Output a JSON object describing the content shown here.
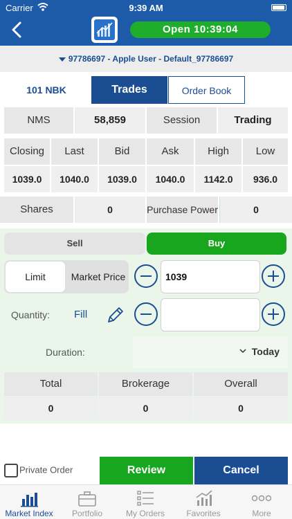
{
  "status_bar": {
    "carrier": "Carrier",
    "time": "9:39 AM"
  },
  "header": {
    "market_status": "Open  10:39:04"
  },
  "account": {
    "label": "97786697 - Apple User - Default_97786697"
  },
  "tabs": {
    "symbol": "101 NBK",
    "trades": "Trades",
    "order_book": "Order Book"
  },
  "market_info": {
    "nms_label": "NMS",
    "nms_value": "58,859",
    "session_label": "Session",
    "session_value": "Trading"
  },
  "prices": {
    "headers": [
      "Closing",
      "Last",
      "Bid",
      "Ask",
      "High",
      "Low"
    ],
    "values": [
      "1039.0",
      "1040.0",
      "1039.0",
      "1040.0",
      "1142.0",
      "936.0"
    ]
  },
  "holdings": {
    "shares_label": "Shares",
    "shares_value": "0",
    "purchase_power_label": "Purchase Power",
    "purchase_power_value": "0"
  },
  "side": {
    "sell": "Sell",
    "buy": "Buy"
  },
  "order_type": {
    "limit": "Limit",
    "market": "Market Price"
  },
  "price_field": {
    "value": "1039"
  },
  "quantity": {
    "label": "Quantity:",
    "fill": "Fill",
    "value": ""
  },
  "duration": {
    "label": "Duration:",
    "value": "Today"
  },
  "summary": {
    "headers": [
      "Total",
      "Brokerage",
      "Overall"
    ],
    "values": [
      "0",
      "0",
      "0"
    ]
  },
  "actions": {
    "private_order": "Private Order",
    "review": "Review",
    "cancel": "Cancel"
  },
  "tabbar": {
    "items": [
      {
        "label": "Market Index",
        "icon": "bar-chart-icon"
      },
      {
        "label": "Portfolio",
        "icon": "briefcase-icon"
      },
      {
        "label": "My Orders",
        "icon": "list-icon"
      },
      {
        "label": "Favorites",
        "icon": "trend-chart-icon"
      },
      {
        "label": "More",
        "icon": "more-icon"
      }
    ]
  },
  "colors": {
    "primary": "#1b4d93",
    "green": "#18a61f",
    "header": "#1d5aa8"
  }
}
